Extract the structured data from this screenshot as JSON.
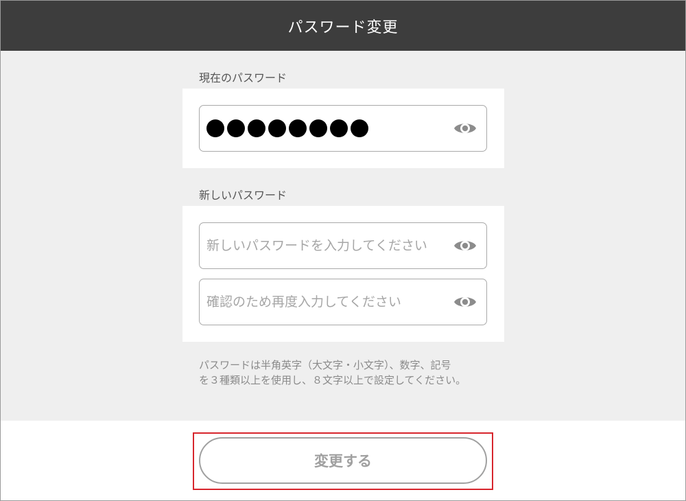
{
  "header": {
    "title": "パスワード変更"
  },
  "current": {
    "label": "現在のパスワード",
    "masked_length": 8
  },
  "new_password": {
    "label": "新しいパスワード",
    "new_placeholder": "新しいパスワードを入力してください",
    "confirm_placeholder": "確認のため再度入力してください"
  },
  "hint": {
    "line1": "パスワードは半角英字（大文字・小文字）、数字、記号",
    "line2": "を３種類以上を使用し、８文字以上で設定してください。"
  },
  "submit": {
    "label": "変更する"
  },
  "icons": {
    "visibility": "eye-icon"
  },
  "colors": {
    "header_bg": "#3d3d3d",
    "page_bg": "#efefef",
    "highlight": "#d7252c",
    "muted": "#a0a0a0"
  }
}
